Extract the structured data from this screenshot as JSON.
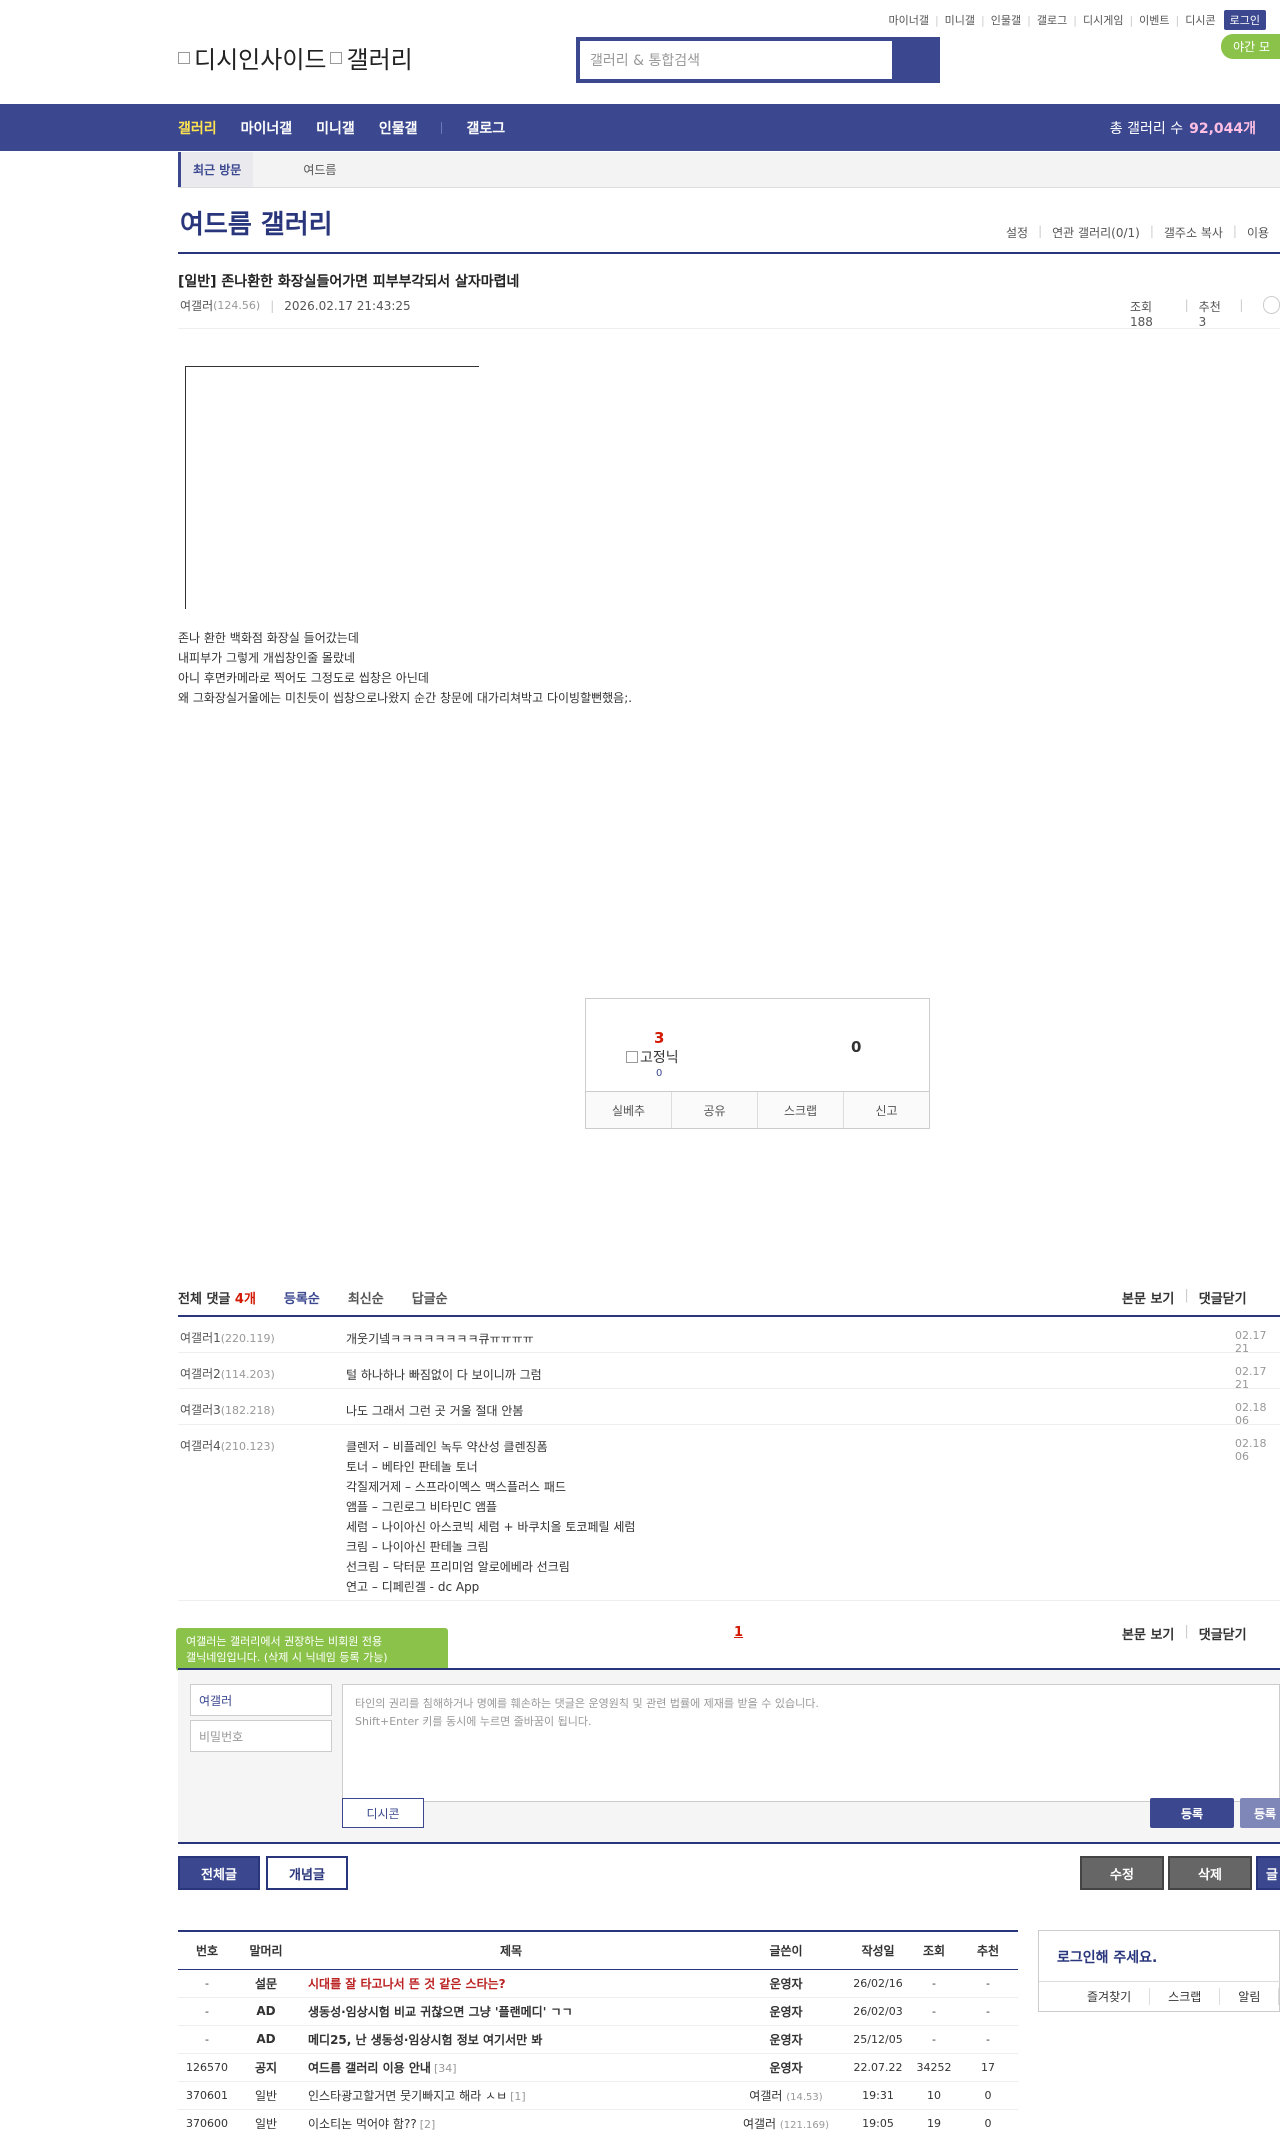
{
  "header": {
    "top_links": [
      "마이너갤",
      "미니갤",
      "인물갤",
      "갤로그",
      "디시게임",
      "이벤트",
      "디시콘"
    ],
    "login_label": "로그인",
    "logo_alt_1": "디시인사이드",
    "logo_alt_2": "갤러리",
    "search_placeholder": "갤러리 & 통합검색",
    "night_mode": "야간 모"
  },
  "gnb": {
    "items": [
      "갤러리",
      "마이너갤",
      "미니갤",
      "인물갤",
      "갤로그"
    ],
    "count_label": "총 갤러리 수",
    "count_value": "92,044개"
  },
  "recent": {
    "label": "최근 방문",
    "items": [
      "여드름"
    ]
  },
  "gallery": {
    "title": "여드름 갤러리",
    "menu": [
      "설정",
      "연관 갤러리(0/1)",
      "갤주소 복사",
      "이용"
    ]
  },
  "post": {
    "title": "[일반] 존나환한 화장실들어가면 피부부각되서 살자마렵네",
    "author": "여갤러",
    "ip": "(124.56)",
    "date": "2026.02.17 21:43:25",
    "views": "조회 188",
    "recommend": "추천 3",
    "body": [
      "존나 환한 백화점 화장실 들어갔는데",
      "내피부가 그렇게 개씹창인줄 몰랐네",
      "아니 후면카메라로 찍어도 그정도로 씹창은 아닌데",
      "왜 그화장실거울에는 미친듯이 씹창으로나왔지 순간 창문에 대가리쳐박고 다이빙할뻔했음;."
    ]
  },
  "recommend_box": {
    "up": "3",
    "img_alt": "고정닉",
    "fixed": "0",
    "down": "0",
    "buttons": [
      "실베추",
      "공유",
      "스크랩",
      "신고"
    ]
  },
  "comments": {
    "total_label": "전체 댓글",
    "total_count": "4개",
    "sorts": [
      "등록순",
      "최신순",
      "답글순"
    ],
    "right": [
      "본문 보기",
      "댓글닫기"
    ],
    "items": [
      {
        "nick": "여갤러1",
        "ip": "(220.119)",
        "text": "개웃기넼ㅋㅋㅋㅋㅋㅋㅋㅋ큐ㅠㅠㅠㅠ",
        "date": "02.17 21"
      },
      {
        "nick": "여갤러2",
        "ip": "(114.203)",
        "text": "털 하나하나 빠짐없이 다 보이니까 그럼",
        "date": "02.17 21"
      },
      {
        "nick": "여갤러3",
        "ip": "(182.218)",
        "text": "나도 그래서 그런 곳 거울 절대 안봄",
        "date": "02.18 06"
      },
      {
        "nick": "여갤러4",
        "ip": "(210.123)",
        "text": "클렌저 – 비플레인 녹두 약산성 클렌징폼\n토너 – 베타인 판테놀 토너\n각질제거제 – 스프라이멕스 맥스플러스 패드\n앰플 – 그린로그 비타민C 앰플\n세럼 – 나이아신 아스코빅 세럼 + 바쿠치올 토코페릴 세럼\n크림 – 나이아신 판테놀 크림\n선크림 – 닥터문 프리미엄 알로에베라 선크림\n연고 – 디페린겔 - dc App",
        "date": "02.18 06"
      }
    ],
    "page": "1"
  },
  "write": {
    "tooltip": "여갤러는 갤러리에서 권장하는 비회원 전용\n갤닉네임입니다. (삭제 시 닉네임 등록 가능)",
    "nick_value": "여갤러",
    "pw_placeholder": "비밀번호",
    "textarea_placeholder": "타인의 권리를 침해하거나 명예를 훼손하는 댓글은 운영원칙 및 관련 법률에 제재를 받을 수 있습니다.\nShift+Enter 키를 동시에 누르면 줄바꿈이 됩니다.",
    "dccon": "디시콘",
    "register": "등록",
    "register2": "등록"
  },
  "actions": {
    "all": "전체글",
    "concept": "개념글",
    "edit": "수정",
    "delete": "삭제",
    "write": "글"
  },
  "list": {
    "headers": [
      "번호",
      "말머리",
      "제목",
      "글쓴이",
      "작성일",
      "조회",
      "추천"
    ],
    "rows": [
      {
        "no": "-",
        "head": "설문",
        "title": "시대를 잘 타고나서 뜬 것 같은 스타는?",
        "style": "red",
        "reply": "",
        "writer": "운영자",
        "wip": "",
        "date": "26/02/16",
        "views": "-",
        "rec": "-"
      },
      {
        "no": "-",
        "head": "AD",
        "title": "생동성·임상시험 비교 귀찮으면 그냥 '플랜메디' ㄱㄱ",
        "style": "",
        "reply": "",
        "writer": "운영자",
        "wip": "",
        "date": "26/02/03",
        "views": "-",
        "rec": "-"
      },
      {
        "no": "-",
        "head": "AD",
        "title": "메디25, 난 생동성·임상시험 정보 여기서만 봐",
        "style": "",
        "reply": "",
        "writer": "운영자",
        "wip": "",
        "date": "25/12/05",
        "views": "-",
        "rec": "-"
      },
      {
        "no": "126570",
        "head": "공지",
        "title": "여드름 갤러리 이용 안내",
        "style": "",
        "reply": "[34]",
        "writer": "운영자",
        "wip": "",
        "date": "22.07.22",
        "views": "34252",
        "rec": "17"
      },
      {
        "no": "370601",
        "head": "일반",
        "title": "인스타광고할거면 뭇기빠지고 해라 ㅅㅂ",
        "style": "normal",
        "reply": "[1]",
        "writer": "여갤러",
        "wip": "(14.53)",
        "date": "19:31",
        "views": "10",
        "rec": "0"
      },
      {
        "no": "370600",
        "head": "일반",
        "title": "이소티논 먹어야 함??",
        "style": "normal",
        "reply": "[2]",
        "writer": "여갤러",
        "wip": "(121.169)",
        "date": "19:05",
        "views": "19",
        "rec": "0"
      }
    ]
  },
  "login_box": {
    "title": "로그인해 주세요.",
    "links": [
      "즐겨찾기",
      "스크랩",
      "알림"
    ]
  }
}
